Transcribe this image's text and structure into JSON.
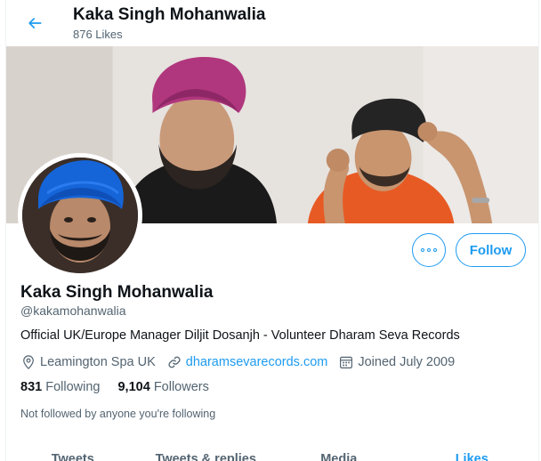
{
  "header": {
    "back_label": "Back",
    "name": "Kaka Singh Mohanwalia",
    "likes_count": "876 Likes"
  },
  "profile": {
    "name": "Kaka Singh Mohanwalia",
    "handle": "@kakamohanwalia",
    "bio": "Official UK/Europe Manager Diljit Dosanjh - Volunteer Dharam Seva Records",
    "location": "Leamington Spa UK",
    "website": "dharamsevarecords.com",
    "joined": "Joined July 2009",
    "following_count": "831",
    "following_label": "Following",
    "followers_count": "9,104",
    "followers_label": "Followers",
    "followed_note": "Not followed by anyone you're following"
  },
  "actions": {
    "follow_label": "Follow"
  },
  "tabs": [
    {
      "label": "Tweets",
      "active": false
    },
    {
      "label": "Tweets & replies",
      "active": false
    },
    {
      "label": "Media",
      "active": false
    },
    {
      "label": "Likes",
      "active": true
    }
  ],
  "colors": {
    "accent": "#1d9bf0",
    "text_primary": "#0f1419",
    "text_secondary": "#536471"
  },
  "icons": {
    "back": "arrow-left-icon",
    "more": "more-dots-icon",
    "location": "location-pin-icon",
    "link": "link-icon",
    "calendar": "calendar-icon"
  }
}
